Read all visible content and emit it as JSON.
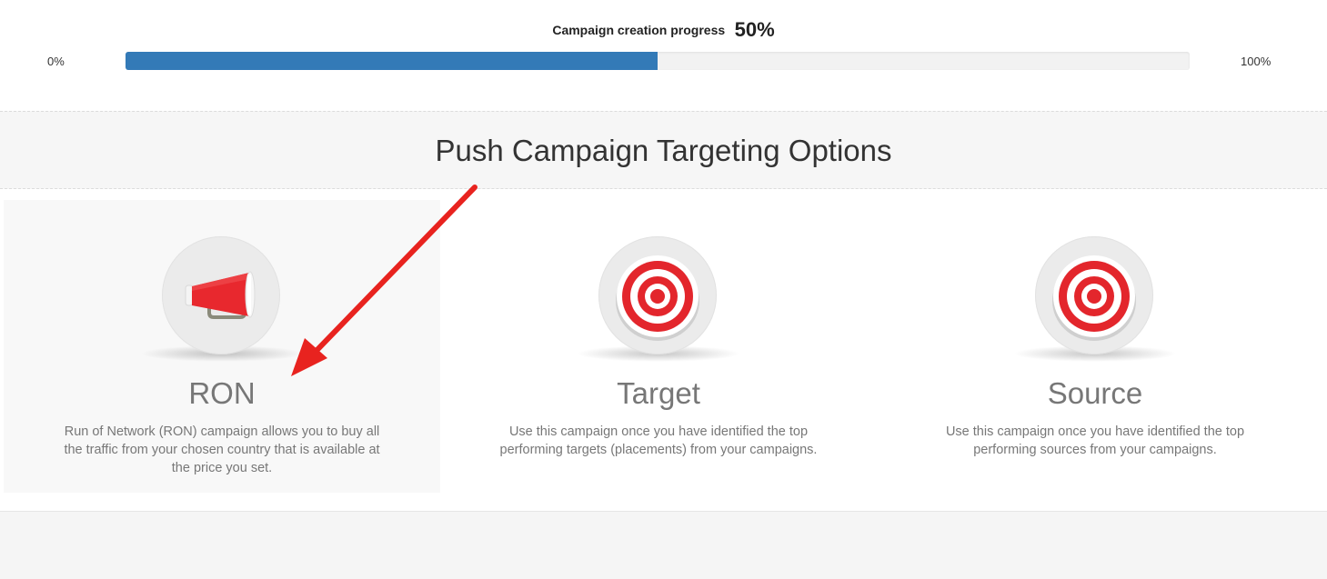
{
  "progress": {
    "label": "Campaign creation progress",
    "value_text": "50%",
    "value": 0.5,
    "min_label": "0%",
    "max_label": "100%",
    "fill_color": "#337ab7"
  },
  "heading": "Push Campaign Targeting Options",
  "options": [
    {
      "title": "RON",
      "description": "Run of Network (RON) campaign allows you to buy all the traffic from your chosen country that is available at the price you set.",
      "icon": "megaphone-icon",
      "selected": true
    },
    {
      "title": "Target",
      "description": "Use this campaign once you have identified the top performing targets (placements) from your campaigns.",
      "icon": "target-icon",
      "selected": false
    },
    {
      "title": "Source",
      "description": "Use this campaign once you have identified the top performing sources from your campaigns.",
      "icon": "target-icon",
      "selected": false
    }
  ],
  "annotation": {
    "icon": "red-arrow-icon",
    "color": "#e8231f"
  }
}
